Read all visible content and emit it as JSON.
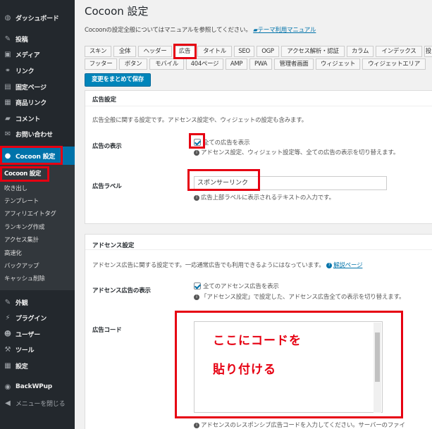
{
  "sidebar": {
    "items": [
      {
        "icon": "dashboard-icon",
        "glyph": "◍",
        "label": "ダッシュボード"
      },
      {
        "icon": "pin-icon",
        "glyph": "✎",
        "label": "投稿"
      },
      {
        "icon": "media-icon",
        "glyph": "▣",
        "label": "メディア"
      },
      {
        "icon": "link-icon",
        "glyph": "⚭",
        "label": "リンク"
      },
      {
        "icon": "page-icon",
        "glyph": "▤",
        "label": "固定ページ"
      },
      {
        "icon": "product-link-icon",
        "glyph": "▦",
        "label": "商品リンク"
      },
      {
        "icon": "comment-icon",
        "glyph": "▰",
        "label": "コメント"
      },
      {
        "icon": "mail-icon",
        "glyph": "✉",
        "label": "お問い合わせ"
      },
      {
        "icon": "cocoon-icon",
        "glyph": "●",
        "label": "Cocoon 設定"
      }
    ],
    "submenu": [
      "Cocoon 設定",
      "吹き出し",
      "テンプレート",
      "アフィリエイトタグ",
      "ランキング作成",
      "アクセス集計",
      "高速化",
      "バックアップ",
      "キャッシュ削除"
    ],
    "bottom_items": [
      {
        "icon": "appearance-icon",
        "glyph": "✎",
        "label": "外観"
      },
      {
        "icon": "plugin-icon",
        "glyph": "⚡",
        "label": "プラグイン"
      },
      {
        "icon": "user-icon",
        "glyph": "☻",
        "label": "ユーザー"
      },
      {
        "icon": "tool-icon",
        "glyph": "⚒",
        "label": "ツール"
      },
      {
        "icon": "settings-icon",
        "glyph": "▦",
        "label": "設定"
      },
      {
        "icon": "backwpup-icon",
        "glyph": "◉",
        "label": "BackWPup"
      },
      {
        "icon": "collapse-icon",
        "glyph": "◀",
        "label": "メニューを閉じる"
      }
    ]
  },
  "header": {
    "title": "Cocoon 設定",
    "desc": "Cocoonの設定全般についてはマニュアルを参照してください。",
    "manual_link": "テーマ利用マニュアル"
  },
  "tabs_row1": [
    "スキン",
    "全体",
    "ヘッダー",
    "広告",
    "タイトル",
    "SEO",
    "OGP",
    "アクセス解析・認証",
    "カラム",
    "インデックス",
    "投"
  ],
  "tabs_row2": [
    "フッター",
    "ボタン",
    "モバイル",
    "404ページ",
    "AMP",
    "PWA",
    "管理者画面",
    "ウィジェット",
    "ウィジェットエリア"
  ],
  "save_button": "変更をまとめて保存",
  "ad_panel": {
    "title": "広告設定",
    "desc": "広告全般に関する設定です。アドセンス設定や、ウィジェットの設定も含みます。",
    "display_label": "広告の表示",
    "display_checkbox": "全ての広告を表示",
    "display_note": "アドセンス設定、ウィジェット設定等、全ての広告の表示を切り替えます。",
    "label_label": "広告ラベル",
    "label_value": "スポンサーリンク",
    "label_note": "広告上部ラベルに表示されるテキストの入力です。"
  },
  "adsense_panel": {
    "title": "アドセンス設定",
    "desc": "アドセンス広告に関する設定です。一応通常広告でも利用できるようにはなっています。",
    "desc_link": "解説ページ",
    "display_label": "アドセンス広告の表示",
    "display_checkbox": "全てのアドセンス広告を表示",
    "display_note": "「アドセンス設定」で設定した、アドセンス広告全ての表示を切り替えます。",
    "code_label": "広告コード",
    "code_note": "アドセンスのレスポンシブ広告コードを入力してください。サーバーのファイ"
  },
  "overlay": {
    "line1": "ここにコードを",
    "line2": "貼り付ける"
  },
  "colors": {
    "sidebar_bg": "#23282d",
    "active_blue": "#0073aa",
    "highlight_red": "#e60012"
  }
}
